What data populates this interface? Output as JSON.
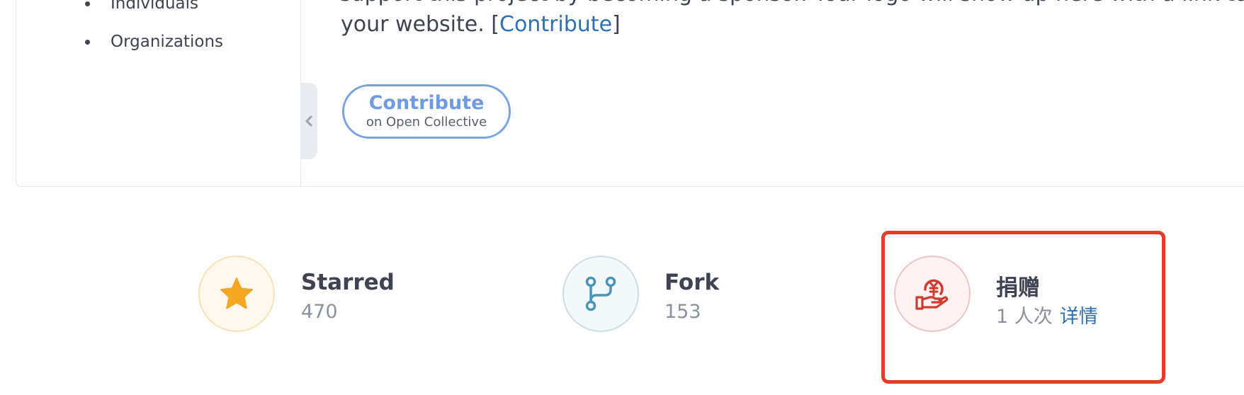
{
  "sidebar": {
    "items": [
      {
        "label": "Individuals"
      },
      {
        "label": "Organizations"
      }
    ]
  },
  "readme": {
    "partial_line": "support this project by becoming a sponsor. Your logo will show up here with a link to",
    "line_prefix": "your website. [",
    "link_label": "Contribute",
    "line_suffix": "]"
  },
  "opencollective": {
    "main_label": "Contribute",
    "sub_label": "on Open Collective"
  },
  "stats": {
    "starred": {
      "label": "Starred",
      "value": "470",
      "icon": "star-icon"
    },
    "fork": {
      "label": "Fork",
      "value": "153",
      "icon": "fork-icon"
    },
    "donate": {
      "label": "捐赠",
      "value": "1 人次",
      "link": "详情",
      "icon": "donate-hand-coin-icon"
    }
  },
  "colors": {
    "link": "#2f6fb3",
    "star": "#f5a623",
    "fork": "#4a94b8",
    "donate": "#d33a2f",
    "highlight": "#e23c2b"
  }
}
